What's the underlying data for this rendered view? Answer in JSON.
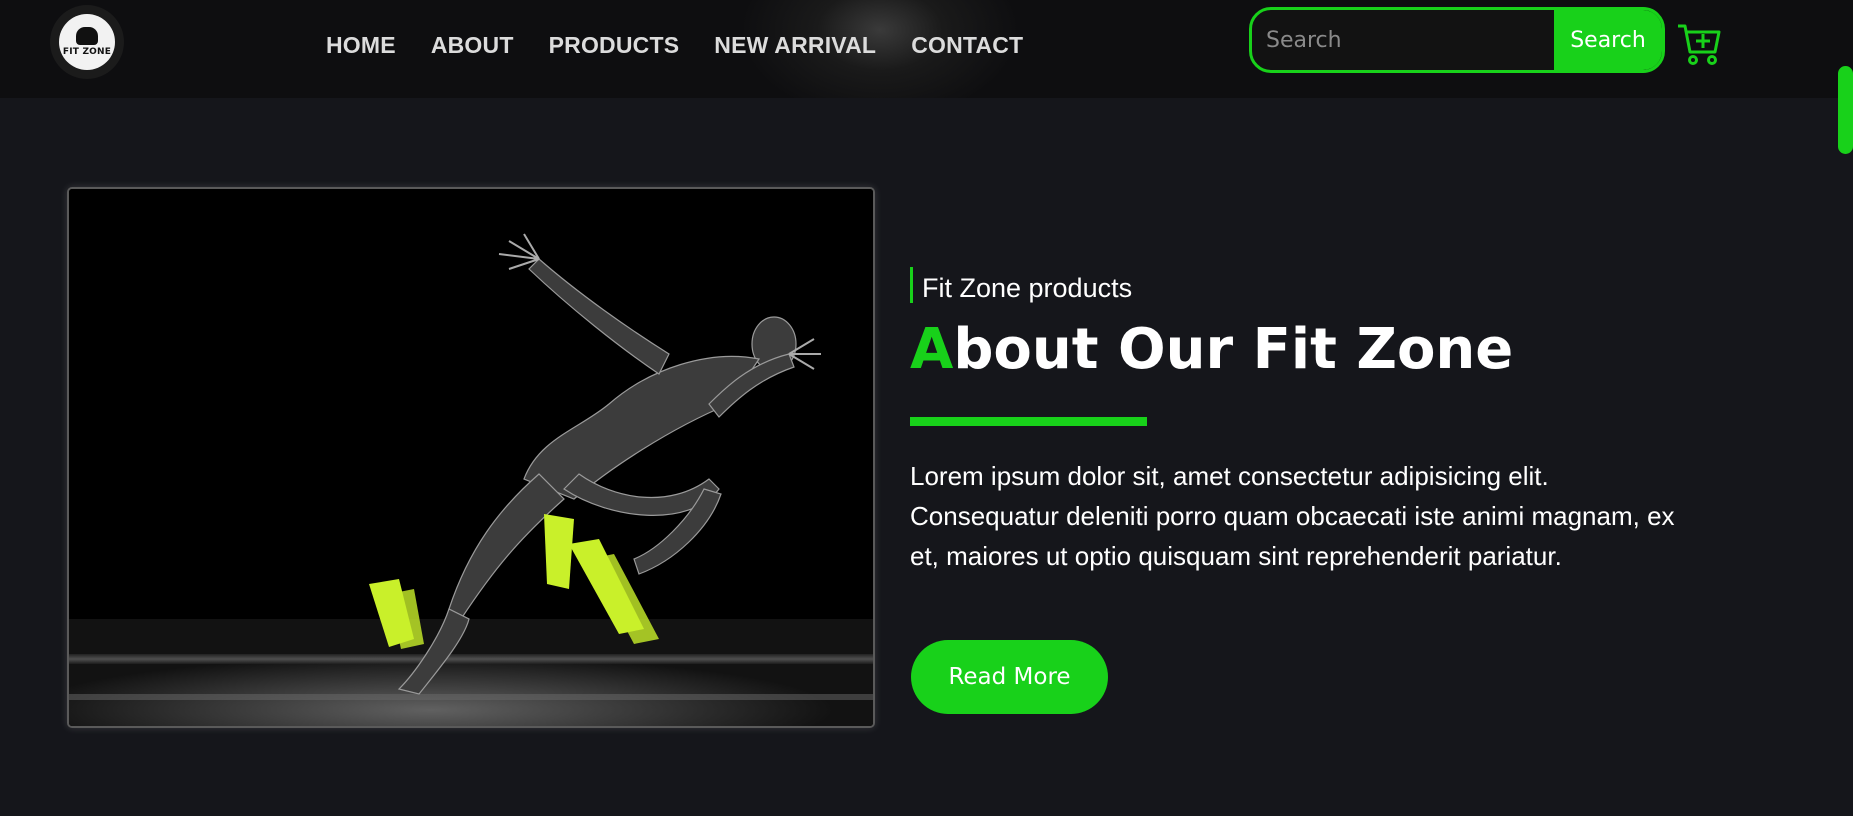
{
  "header": {
    "logo_text": "FIT ZONE",
    "nav": [
      {
        "label": "HOME"
      },
      {
        "label": "ABOUT"
      },
      {
        "label": "PRODUCTS"
      },
      {
        "label": "NEW ARRIVAL"
      },
      {
        "label": "CONTACT"
      }
    ],
    "search": {
      "placeholder": "Search",
      "value": "",
      "button_label": "Search"
    },
    "cart_icon": "cart-plus-icon"
  },
  "about": {
    "eyebrow": "Fit Zone products",
    "title_first_letter": "A",
    "title_rest": "bout Our Fit Zone",
    "paragraph": "Lorem ipsum dolor sit, amet consectetur adipisicing elit. Consequatur deleniti porro quam obcaecati iste animi magnam, ex et, maiores ut optio quisquam sint reprehenderit pariatur.",
    "read_more_label": "Read More"
  },
  "colors": {
    "accent": "#18d11a",
    "background": "#15161b",
    "header": "#0e0e10",
    "text": "#ffffff"
  }
}
